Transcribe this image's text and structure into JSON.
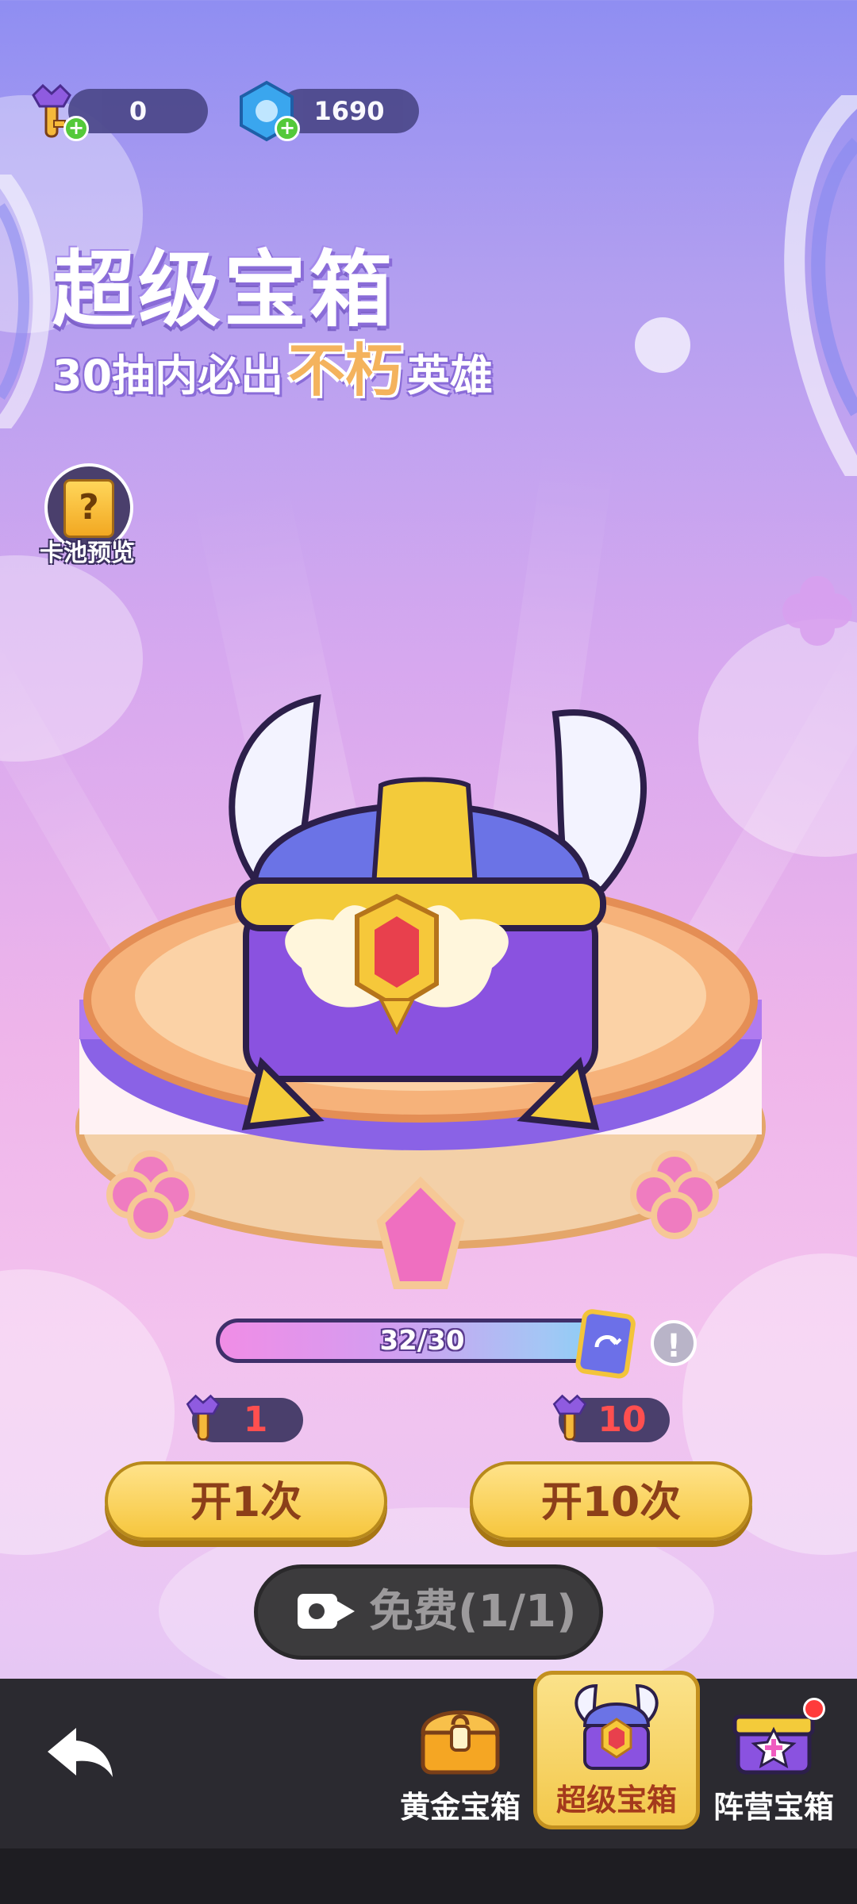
{
  "currency": {
    "keys": {
      "icon": "purple-key-icon",
      "value": "0"
    },
    "gems": {
      "icon": "blue-crystal-icon",
      "value": "1690"
    }
  },
  "title": "超级宝箱",
  "subtitle": {
    "prefix": "30抽内必出",
    "highlight": "不朽",
    "suffix": "英雄"
  },
  "pool_preview": {
    "icon": "question-card-icon",
    "label": "卡池预览"
  },
  "progress": {
    "text": "32/30",
    "current": 32,
    "max": 30
  },
  "costs": {
    "single": {
      "icon": "purple-key-icon",
      "value": "1"
    },
    "ten": {
      "icon": "purple-key-icon",
      "value": "10"
    }
  },
  "buttons": {
    "open_once": "开1次",
    "open_ten": "开10次",
    "free": "免费(1/1)"
  },
  "tabs": [
    {
      "label": "黄金宝箱",
      "icon": "gold-chest-icon",
      "active": false
    },
    {
      "label": "超级宝箱",
      "icon": "super-chest-icon",
      "active": true
    },
    {
      "label": "阵营宝箱",
      "icon": "faction-chest-icon",
      "active": false,
      "badge": true
    }
  ],
  "colors": {
    "button_yellow": "#f6c63d",
    "button_text": "#8c3f19",
    "cost_red": "#ff4f4f",
    "highlight_orange": "#f4b35d"
  }
}
